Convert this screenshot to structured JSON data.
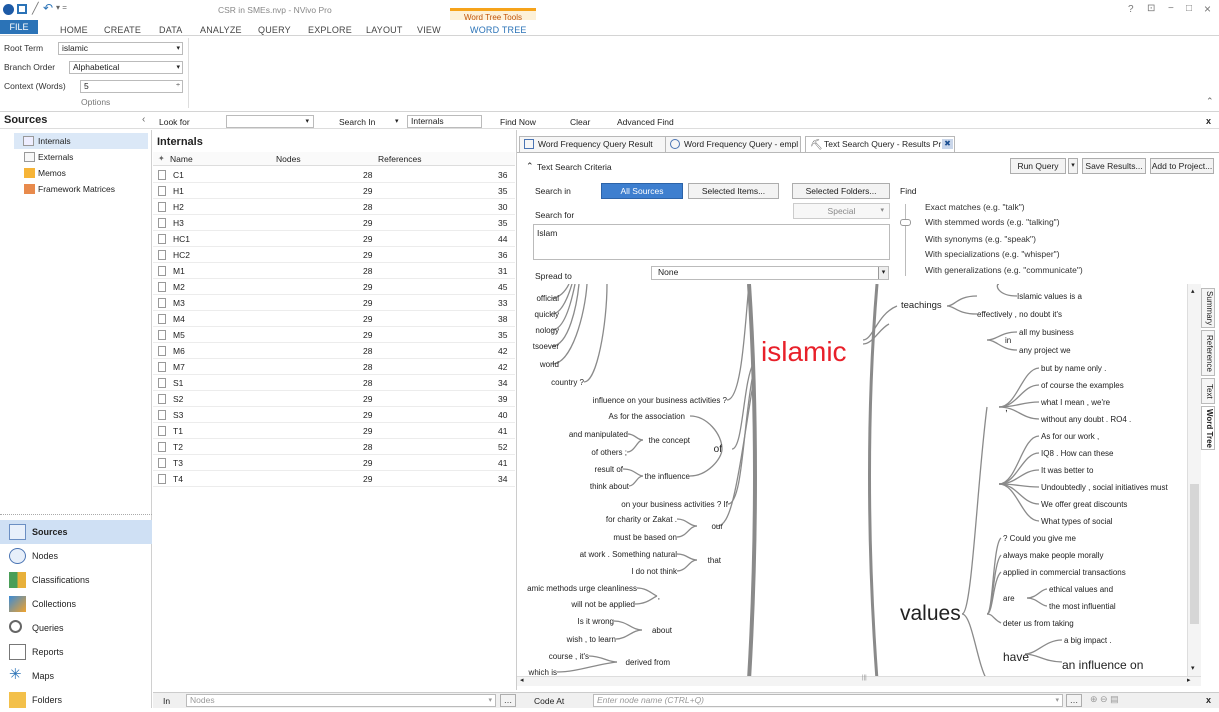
{
  "window": {
    "title": "CSR in SMEs.nvp - NVivo Pro",
    "context_group": "Word Tree Tools"
  },
  "ribbon": {
    "tabs": [
      "HOME",
      "CREATE",
      "DATA",
      "ANALYZE",
      "QUERY",
      "EXPLORE",
      "LAYOUT",
      "VIEW"
    ],
    "file_tab": "FILE",
    "active_context_tab": "WORD TREE",
    "root_term_label": "Root Term",
    "root_term_value": "islamic",
    "branch_order_label": "Branch Order",
    "branch_order_value": "Alphabetical",
    "context_label": "Context (Words)",
    "context_value": "5",
    "group_label": "Options"
  },
  "window_controls": {
    "help": "?",
    "restore": "⊡",
    "min": "−",
    "max": "□",
    "close": "×"
  },
  "findbar": {
    "look_for_label": "Look for",
    "look_for_value": "",
    "search_in_label": "Search In",
    "search_in_value": "Internals",
    "find_now": "Find Now",
    "clear": "Clear",
    "advanced_find": "Advanced Find",
    "close": "x"
  },
  "sources": {
    "title": "Sources",
    "tree": [
      "Internals",
      "Externals",
      "Memos",
      "Framework Matrices"
    ],
    "nav_buttons": [
      "Sources",
      "Nodes",
      "Classifications",
      "Collections",
      "Queries",
      "Reports",
      "Maps",
      "Folders"
    ]
  },
  "list": {
    "title": "Internals",
    "columns": [
      "Name",
      "Nodes",
      "References"
    ],
    "rows": [
      {
        "name": "C1",
        "nodes": "28",
        "refs": "36"
      },
      {
        "name": "H1",
        "nodes": "29",
        "refs": "35"
      },
      {
        "name": "H2",
        "nodes": "28",
        "refs": "30"
      },
      {
        "name": "H3",
        "nodes": "29",
        "refs": "35"
      },
      {
        "name": "HC1",
        "nodes": "29",
        "refs": "44"
      },
      {
        "name": "HC2",
        "nodes": "29",
        "refs": "36"
      },
      {
        "name": "M1",
        "nodes": "28",
        "refs": "31"
      },
      {
        "name": "M2",
        "nodes": "29",
        "refs": "45"
      },
      {
        "name": "M3",
        "nodes": "29",
        "refs": "33"
      },
      {
        "name": "M4",
        "nodes": "29",
        "refs": "38"
      },
      {
        "name": "M5",
        "nodes": "29",
        "refs": "35"
      },
      {
        "name": "M6",
        "nodes": "28",
        "refs": "42"
      },
      {
        "name": "M7",
        "nodes": "28",
        "refs": "42"
      },
      {
        "name": "S1",
        "nodes": "28",
        "refs": "34"
      },
      {
        "name": "S2",
        "nodes": "29",
        "refs": "39"
      },
      {
        "name": "S3",
        "nodes": "29",
        "refs": "40"
      },
      {
        "name": "T1",
        "nodes": "29",
        "refs": "41"
      },
      {
        "name": "T2",
        "nodes": "28",
        "refs": "52"
      },
      {
        "name": "T3",
        "nodes": "29",
        "refs": "41"
      },
      {
        "name": "T4",
        "nodes": "29",
        "refs": "34"
      }
    ]
  },
  "detail": {
    "tabs": [
      "Word Frequency Query Result",
      "Word Frequency Query - empl",
      "Text Search Query - Results Pr"
    ],
    "criteria_label": "Text Search Criteria",
    "run_query": "Run Query",
    "save_results": "Save Results...",
    "add_to_project": "Add to Project...",
    "search_in_label": "Search in",
    "all_sources": "All Sources",
    "selected_items": "Selected Items...",
    "selected_folders": "Selected Folders...",
    "find_label": "Find",
    "special": "Special",
    "search_for_label": "Search for",
    "search_for_value": "Islam",
    "spread_to_label": "Spread to",
    "spread_to_value": "None",
    "find_options": [
      "Exact matches (e.g. \"talk\")",
      "With stemmed words (e.g. \"talking\")",
      "With synonyms (e.g. \"speak\")",
      "With specializations (e.g. \"whisper\")",
      "With generalizations (e.g. \"communicate\")"
    ],
    "side_tabs": [
      "Summary",
      "Reference",
      "Text",
      "Word Tree"
    ]
  },
  "wordtree": {
    "root": "islamic",
    "left": [
      "official",
      "quickly",
      "nology",
      "tsoever",
      "world",
      "country ?",
      "influence on your business activities ?",
      "As for the association",
      "and manipulated",
      "the concept",
      "of others ;",
      "of",
      "result of",
      "the influence",
      "think about",
      "on your business activities ? If",
      "for charity or Zakat .",
      "our",
      "must be based on",
      "at work . Something natural",
      "that",
      "I do not think",
      "amic methods urge cleanliness",
      "will not be applied",
      ",",
      "Is it wrong",
      "about",
      "wish , to learn",
      "course , it's",
      "derived from",
      "which is"
    ],
    "right": [
      "Islamic values is a",
      "teachings",
      "effectively , no doubt it's",
      "all my business",
      "in",
      "any project we",
      "but by name only .",
      "of course the examples",
      "what I mean , we're",
      "without any doubt . RO4 .",
      ",",
      "As for our work ,",
      "IQ8 . How can these",
      "It was better to",
      "Undoubtedly , social initiatives must",
      "We offer great discounts",
      "What types of social",
      "? Could you give me",
      "always make people morally",
      "applied in commercial transactions",
      "ethical values and",
      "are",
      "the most influential",
      "deter us from taking",
      "values",
      "a big impact .",
      "have",
      "an influence on"
    ]
  },
  "bottombar": {
    "in_label": "In",
    "in_value": "Nodes",
    "code_at_label": "Code At",
    "code_at_placeholder": "Enter node name (CTRL+Q)",
    "close": "x"
  },
  "colors": {
    "accent": "#2b73b7",
    "root": "#e8202a",
    "context": "#f6a31a"
  }
}
